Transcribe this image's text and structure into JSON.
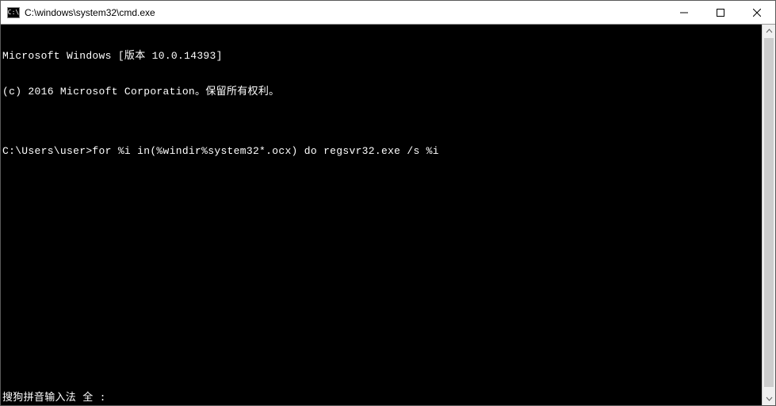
{
  "window": {
    "icon_label": "C:\\",
    "title": "C:\\windows\\system32\\cmd.exe"
  },
  "controls": {
    "minimize_name": "minimize-button",
    "maximize_name": "maximize-button",
    "close_name": "close-button"
  },
  "console": {
    "lines": [
      "Microsoft Windows [版本 10.0.14393]",
      "(c) 2016 Microsoft Corporation。保留所有权利。",
      "",
      "C:\\Users\\user>for %i in(%windir%system32*.ocx) do regsvr32.exe /s %i"
    ],
    "ime_status": "搜狗拼音输入法 全 :"
  },
  "scrollbar": {
    "orientation": "vertical"
  }
}
